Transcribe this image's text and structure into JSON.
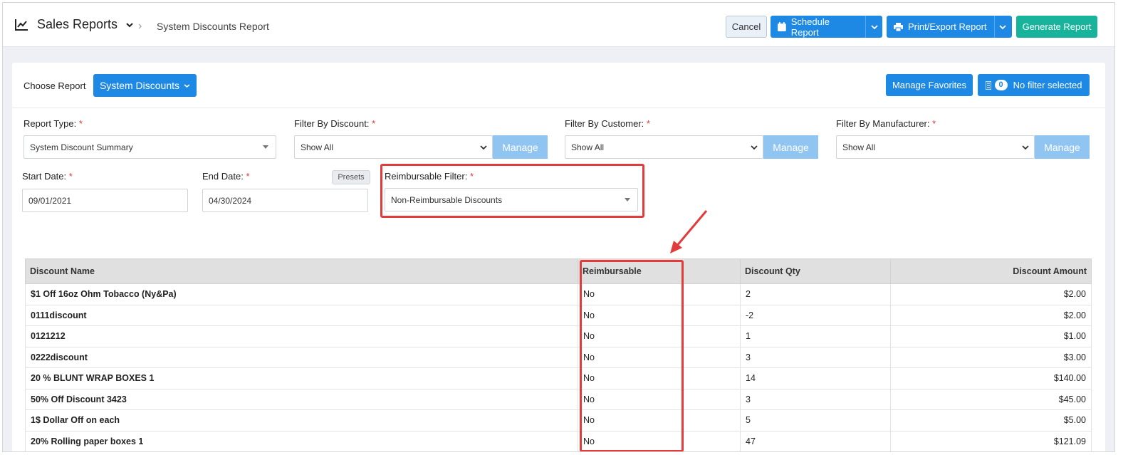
{
  "header": {
    "title": "Sales Reports",
    "breadcrumb": "System Discounts Report",
    "cancel": "Cancel",
    "schedule": "Schedule Report",
    "print": "Print/Export Report",
    "generate": "Generate Report"
  },
  "card": {
    "choose_label": "Choose Report",
    "choose_value": "System Discounts",
    "favorites": "Manage Favorites",
    "filter_count": "0",
    "filter_text": "No filter selected"
  },
  "filters": {
    "report_type": {
      "label": "Report Type:",
      "value": "System Discount Summary"
    },
    "discount": {
      "label": "Filter By Discount:",
      "value": "Show All",
      "manage": "Manage"
    },
    "customer": {
      "label": "Filter By Customer:",
      "value": "Show All",
      "manage": "Manage"
    },
    "manufacturer": {
      "label": "Filter By Manufacturer:",
      "value": "Show All",
      "manage": "Manage"
    },
    "start_date": {
      "label": "Start Date:",
      "value": "09/01/2021"
    },
    "end_date": {
      "label": "End Date:",
      "value": "04/30/2024"
    },
    "presets": "Presets",
    "reimbursable": {
      "label": "Reimbursable Filter:",
      "value": "Non-Reimbursable Discounts"
    },
    "required_mark": "*"
  },
  "table": {
    "headers": [
      "Discount Name",
      "Reimbursable",
      "Discount Qty",
      "Discount Amount"
    ],
    "rows": [
      [
        "$1 Off 16oz Ohm Tobacco (Ny&Pa)",
        "No",
        "2",
        "$2.00"
      ],
      [
        "0111discount",
        "No",
        "-2",
        "$2.00"
      ],
      [
        "0121212",
        "No",
        "1",
        "$1.00"
      ],
      [
        "0222discount",
        "No",
        "3",
        "$3.00"
      ],
      [
        "20 % BLUNT WRAP BOXES 1",
        "No",
        "14",
        "$140.00"
      ],
      [
        "50% Off Discount 3423",
        "No",
        "3",
        "$45.00"
      ],
      [
        "1$ Dollar Off on each",
        "No",
        "5",
        "$5.00"
      ],
      [
        "20% Rolling paper boxes 1",
        "No",
        "47",
        "$121.09"
      ]
    ]
  },
  "colors": {
    "primary": "#1e88e5",
    "success": "#17b39a",
    "highlight": "#e23b3b"
  }
}
